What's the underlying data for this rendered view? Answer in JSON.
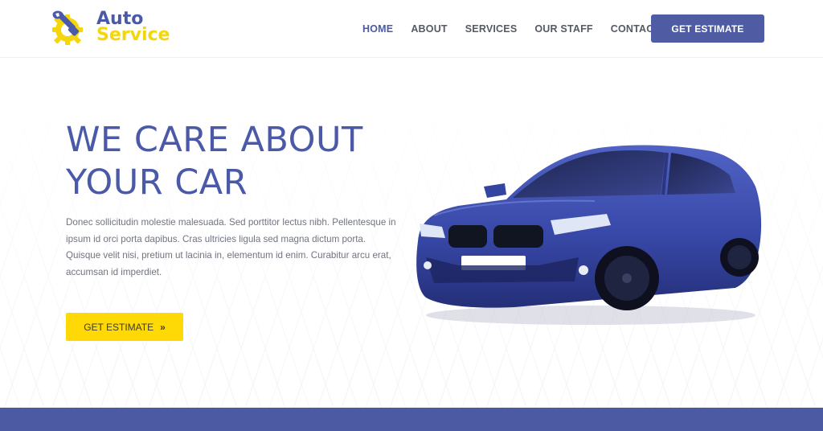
{
  "brand": {
    "line1": "Auto",
    "line2": "Service",
    "colors": {
      "primary": "#4b5aa8",
      "accent": "#f5d60c"
    }
  },
  "nav": {
    "items": [
      {
        "label": "HOME",
        "active": true
      },
      {
        "label": "ABOUT"
      },
      {
        "label": "SERVICES"
      },
      {
        "label": "OUR STAFF"
      },
      {
        "label": "CONTACT"
      }
    ],
    "cta_label": "GET ESTIMATE"
  },
  "hero": {
    "headline_line1": "WE CARE ABOUT",
    "headline_line2": "YOUR CAR",
    "description": "Donec sollicitudin molestie malesuada. Sed porttitor lectus nibh. Pellentesque in ipsum id orci porta dapibus. Cras ultricies ligula sed magna dictum porta. Quisque velit nisi, pretium ut lacinia in, elementum id enim. Curabitur arcu erat, accumsan id imperdiet.",
    "cta_label": "GET ESTIMATE",
    "cta_icon": "double-chevron-right-icon",
    "image": "blue-sedan-car"
  },
  "icons": {
    "logo": "wrench-gear-icon"
  }
}
